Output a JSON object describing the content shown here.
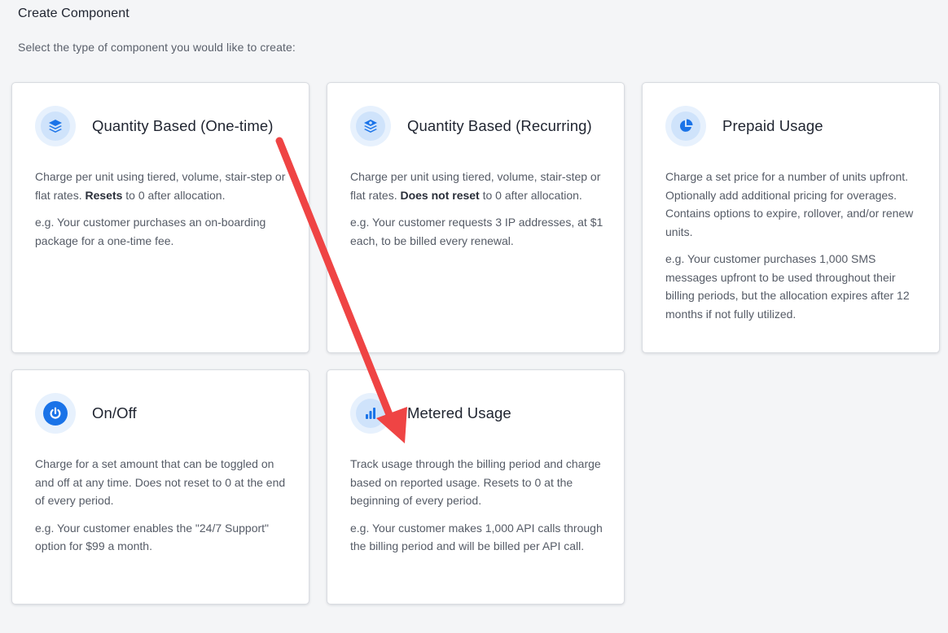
{
  "header": {
    "title": "Create Component",
    "subtitle": "Select the type of component you would like to create:"
  },
  "colors": {
    "icon_blue": "#1a73e8",
    "icon_bg": "#e7f1fd",
    "annotation_arrow": "#ef4444"
  },
  "cards": [
    {
      "title": "Quantity Based (One-time)",
      "icon": "layers-icon",
      "desc_pre": "Charge per unit using tiered, volume, stair-step or flat rates. ",
      "desc_bold": "Resets",
      "desc_post": " to 0 after allocation.",
      "example": "e.g. Your customer purchases an on-boarding package for a one-time fee."
    },
    {
      "title": "Quantity Based (Recurring)",
      "icon": "layers-recurring-icon",
      "desc_pre": "Charge per unit using tiered, volume, stair-step or flat rates. ",
      "desc_bold": "Does not reset",
      "desc_post": " to 0 after allocation.",
      "example": "e.g. Your customer requests 3 IP addresses, at $1 each, to be billed every renewal."
    },
    {
      "title": "Prepaid Usage",
      "icon": "pie-chart-icon",
      "desc": "Charge a set price for a number of units upfront. Optionally add additional pricing for overages. Contains options to expire, rollover, and/or renew units.",
      "example": "e.g. Your customer purchases 1,000 SMS messages upfront to be used throughout their billing periods, but the allocation expires after 12 months if not fully utilized."
    },
    {
      "title": "On/Off",
      "icon": "power-icon",
      "desc": "Charge for a set amount that can be toggled on and off at any time. Does not reset to 0 at the end of every period.",
      "example": "e.g. Your customer enables the \"24/7 Support\" option for $99 a month."
    },
    {
      "title": "Metered Usage",
      "icon": "bar-chart-icon",
      "desc": "Track usage through the billing period and charge based on reported usage. Resets to 0 at the beginning of every period.",
      "example": "e.g. Your customer makes 1,000 API calls through the billing period and will be billed per API call."
    }
  ]
}
